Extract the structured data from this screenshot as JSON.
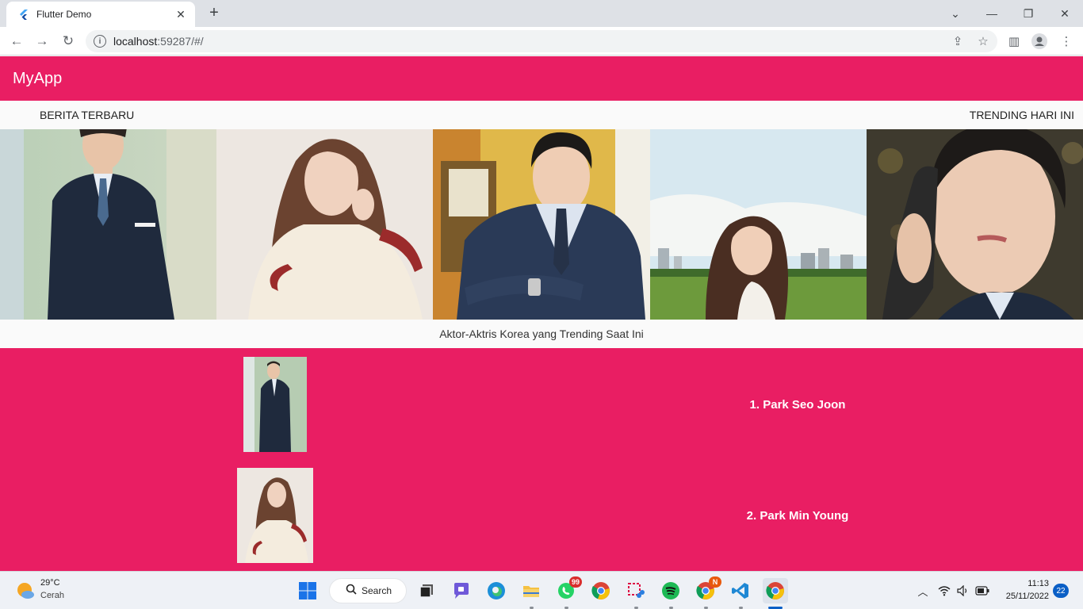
{
  "browser": {
    "tab_title": "Flutter Demo",
    "new_tab": "+",
    "url_host": "localhost",
    "url_rest": ":59287/#/"
  },
  "app": {
    "title": "MyApp",
    "nav_left": "BERITA TERBARU",
    "nav_right": "TRENDING HARI INI",
    "caption": "Aktor-Aktris Korea yang Trending Saat Ini",
    "actors": [
      {
        "name": "1. Park Seo Joon"
      },
      {
        "name": "2. Park Min Young"
      }
    ]
  },
  "taskbar": {
    "weather_temp": "29°C",
    "weather_cond": "Cerah",
    "search_label": "Search",
    "whatsapp_badge": "99",
    "chrome_badge": "N",
    "time": "11:13",
    "date": "25/11/2022",
    "notifications": "22"
  },
  "colors": {
    "primary": "#e91e63",
    "accent_blue": "#0a5fc6"
  }
}
